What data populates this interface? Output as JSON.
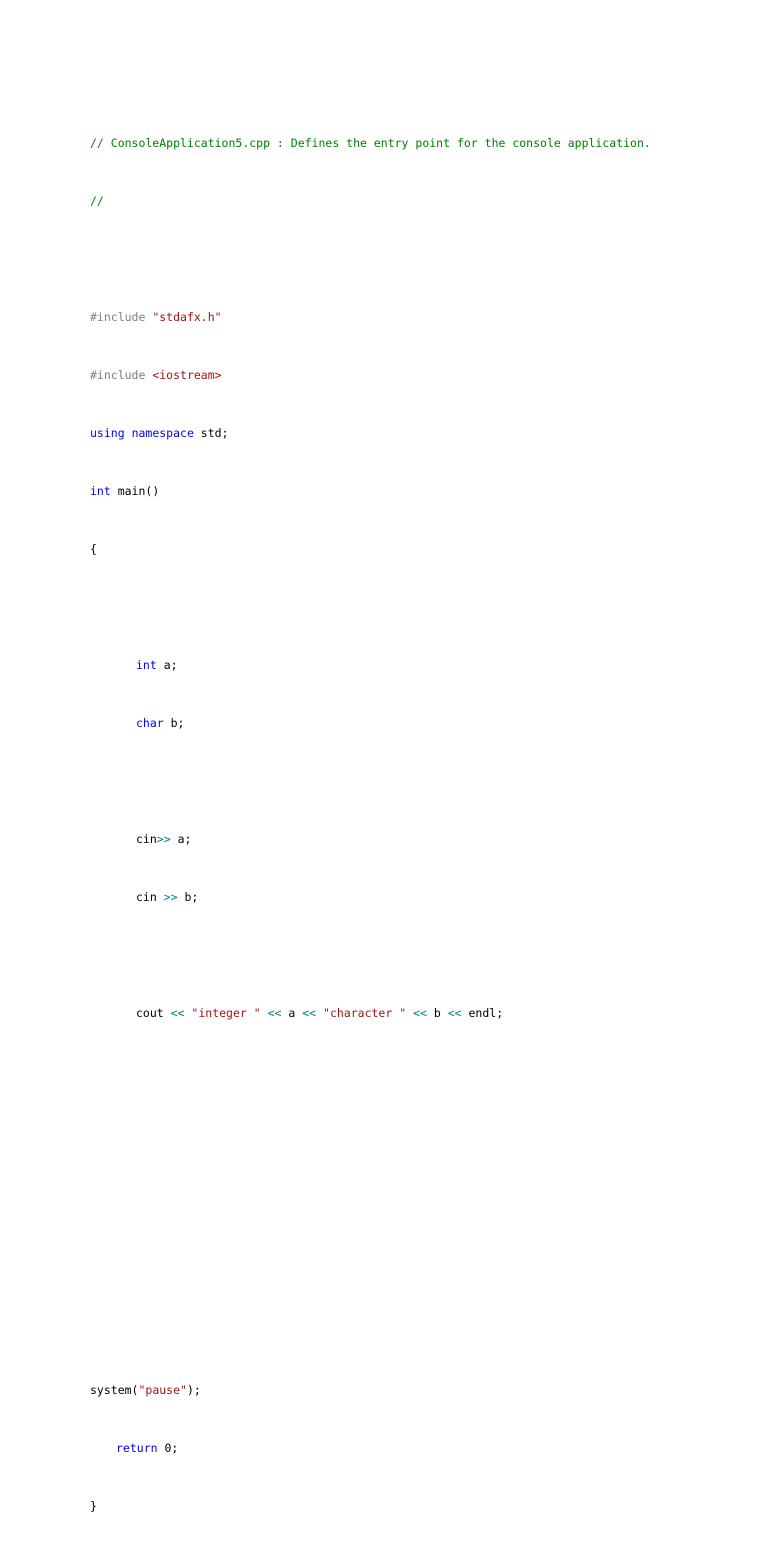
{
  "code": {
    "comment_line_1": "// ConsoleApplication5.cpp : Defines the entry point for the console application.",
    "comment_line_2": "//",
    "include_1_directive": "#include",
    "include_1_file": "\"stdafx.h\"",
    "include_2_directive": "#include",
    "include_2_file": "<iostream>",
    "using_kw": "using",
    "namespace_kw": "namespace",
    "using_rest": " std;",
    "main_kw": "int",
    "main_rest": " main()",
    "open_brace": "{",
    "decl_a_type": "int",
    "decl_a_rest": " a;",
    "decl_b_type": "char",
    "decl_b_rest": " b;",
    "cin_a_obj": "cin",
    "cin_a_op": ">>",
    "cin_a_rest": " a;",
    "cin_b_obj": "cin ",
    "cin_b_op": ">>",
    "cin_b_rest": " b;",
    "cout_obj": "cout ",
    "cout_op1": "<<",
    "cout_str1": "\"integer \"",
    "cout_op2": "<<",
    "cout_var_a": " a ",
    "cout_op3": "<<",
    "cout_str2": "\"character \"",
    "cout_op4": "<<",
    "cout_var_b": " b ",
    "cout_op5": "<<",
    "cout_endl": " endl;",
    "system_call": "system(",
    "system_arg": "\"pause\"",
    "system_close": ");",
    "return_kw": "return",
    "return_rest": " 0;",
    "close_brace": "}"
  }
}
